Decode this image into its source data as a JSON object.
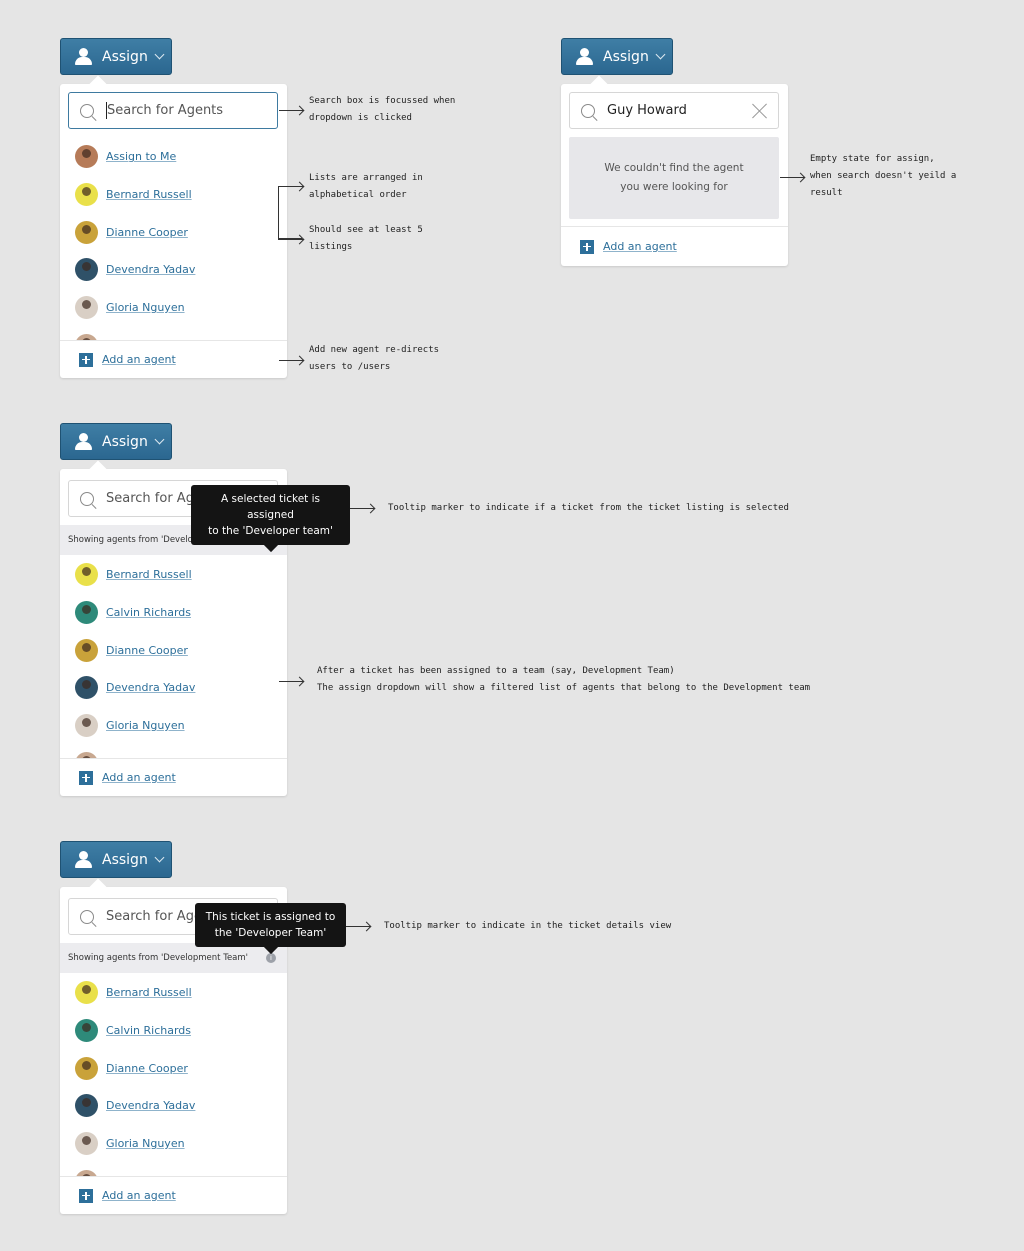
{
  "assign_label": "Assign",
  "add_agent_label": "Add an agent",
  "colors": {
    "primary": "#2b6790",
    "link": "#2d6f9a",
    "background": "#e5e5e5",
    "tooltip": "#141414"
  },
  "panel1": {
    "search_placeholder": "Search for Agents",
    "items": [
      {
        "name": "Assign to Me",
        "avatar": "#b67b58"
      },
      {
        "name": "Bernard Russell",
        "avatar": "#e9e04a"
      },
      {
        "name": "Dianne Cooper",
        "avatar": "#c9a23a"
      },
      {
        "name": "Devendra Yadav",
        "avatar": "#2f5168"
      },
      {
        "name": "Gloria Nguyen",
        "avatar": "#d9cfc5"
      }
    ]
  },
  "panel2": {
    "search_value": "Guy Howard",
    "empty_line1": "We couldn't find the agent",
    "empty_line2": "you were looking for"
  },
  "panel3": {
    "search_placeholder": "Search for Agents",
    "banner": "Showing agents from 'Development Team'",
    "tooltip_line1": "A selected ticket is assigned",
    "tooltip_line2": "to the 'Developer team'",
    "items": [
      {
        "name": "Bernard Russell",
        "avatar": "#e9e04a"
      },
      {
        "name": "Calvin Richards",
        "avatar": "#2e8a7a"
      },
      {
        "name": "Dianne Cooper",
        "avatar": "#c9a23a"
      },
      {
        "name": "Devendra Yadav",
        "avatar": "#2f5168"
      },
      {
        "name": "Gloria Nguyen",
        "avatar": "#d9cfc5"
      }
    ]
  },
  "panel4": {
    "search_placeholder": "Search for Agents",
    "banner": "Showing agents from 'Development Team'",
    "tooltip_line1": "This ticket is assigned to",
    "tooltip_line2": "the 'Developer Team'",
    "items": [
      {
        "name": "Bernard Russell",
        "avatar": "#e9e04a"
      },
      {
        "name": "Calvin Richards",
        "avatar": "#2e8a7a"
      },
      {
        "name": "Dianne Cooper",
        "avatar": "#c9a23a"
      },
      {
        "name": "Devendra Yadav",
        "avatar": "#2f5168"
      },
      {
        "name": "Gloria Nguyen",
        "avatar": "#d9cfc5"
      }
    ]
  },
  "notes": {
    "search_focus": "Search box is focussed when\ndropdown is clicked",
    "alphabetical": "Lists are arranged in\nalphabetical order",
    "min_listings": "Should see at least 5\nlistings",
    "add_agent": "Add new agent re-directs\nusers to /users",
    "empty_state": "Empty state for assign,\nwhen search doesn't yeild a\nresult",
    "tooltip_listing": "Tooltip marker to indicate if a ticket from the ticket listing is selected",
    "filtered": "After a ticket has been assigned to a team (say, Development Team)\nThe assign dropdown will show a filtered list of agents that belong to the Development team",
    "tooltip_details": "Tooltip marker to indicate in the ticket details view"
  }
}
